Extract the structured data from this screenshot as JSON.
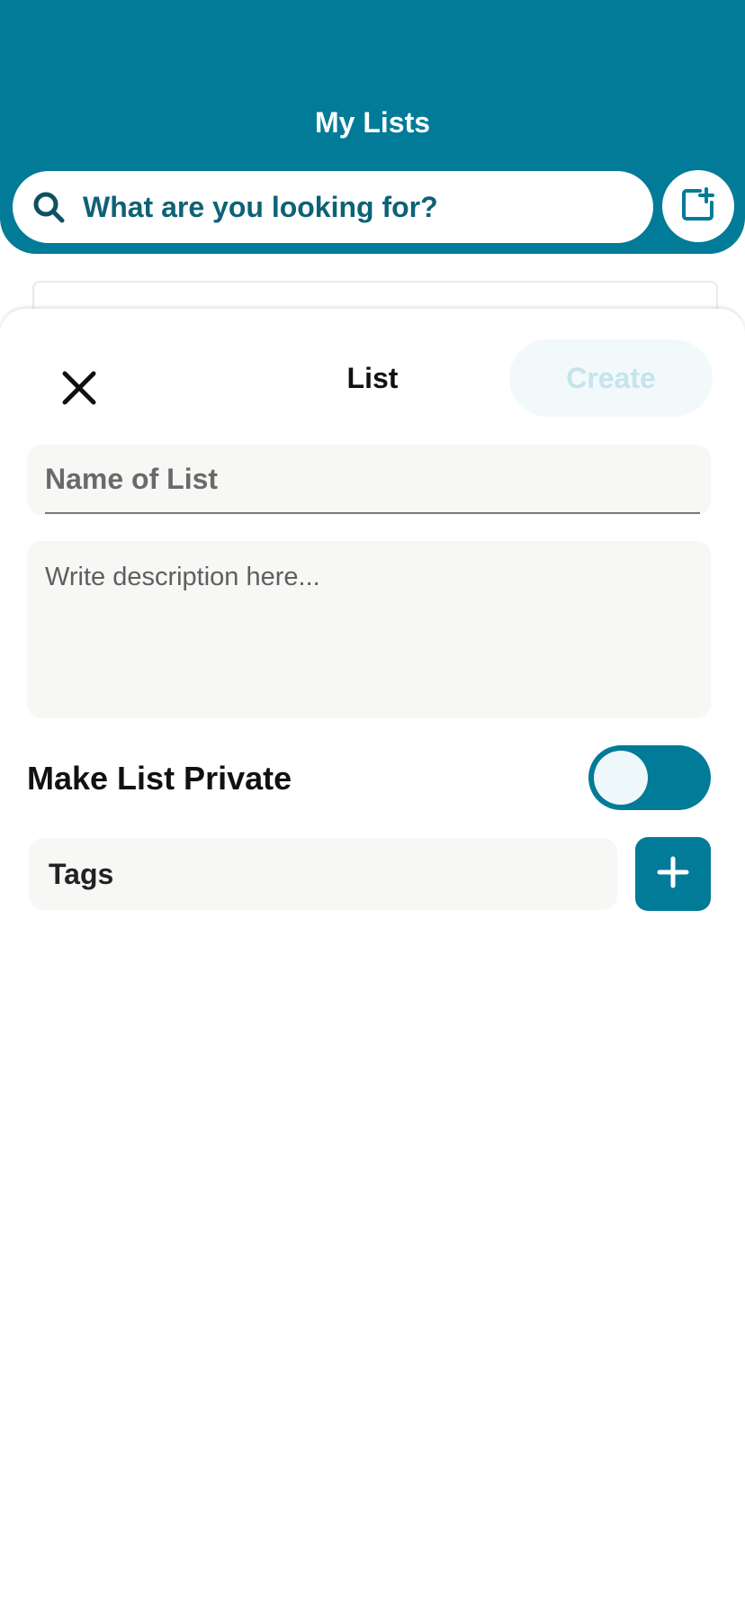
{
  "header": {
    "title": "My Lists",
    "search_placeholder": "What are you looking for?",
    "search_icon": "search-icon",
    "new_list_icon": "add-box-icon"
  },
  "sheet": {
    "close_icon": "close-icon",
    "title": "List",
    "create_label": "Create",
    "create_enabled": false,
    "name_placeholder": "Name of List",
    "description_placeholder": "Write description here...",
    "private_label": "Make List Private",
    "private_toggle_on": false,
    "tags_label": "Tags",
    "add_tag_icon": "plus-icon"
  },
  "colors": {
    "primary": "#017b98",
    "search_text": "#0d6276",
    "create_disabled_bg": "#f2f9fb",
    "create_disabled_text": "#c5e4ec",
    "field_bg": "#f7f7f5"
  }
}
